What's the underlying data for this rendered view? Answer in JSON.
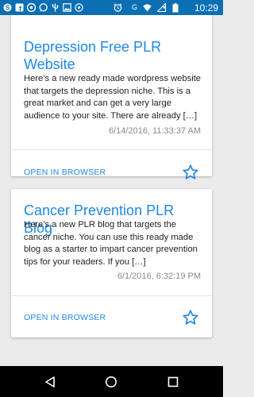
{
  "status_bar": {
    "time": "10:29",
    "icons": [
      "skype-icon",
      "facebook-icon",
      "chrome-icon",
      "whatsapp-icon",
      "usb-icon",
      "image-icon",
      "signal-circle-icon",
      "alarm-icon",
      "google-icon",
      "wifi-icon",
      "no-sim-icon",
      "battery-icon"
    ],
    "google_letter": "G"
  },
  "posts": [
    {
      "title": "Depression Free PLR Website",
      "excerpt": "Here’s a new ready made wordpress website that targets the depression niche. This is a great market and can get a very large audience to your site. There are already […]",
      "date": "6/14/2016, 11:33:37 AM",
      "open_label": "OPEN IN BROWSER",
      "favorite_icon": "star-outline-icon"
    },
    {
      "title": "Cancer Prevention PLR Blog",
      "excerpt": "Here’s a new PLR blog that targets the cancer niche. You can use this ready made blog as a starter to impart cancer prevention tips for your readers. If you […]",
      "date": "6/1/2016, 6:32:19 PM",
      "open_label": "OPEN IN BROWSER",
      "favorite_icon": "star-outline-icon"
    }
  ],
  "nav_bar": {
    "buttons": [
      "back-icon",
      "home-icon",
      "recents-icon"
    ]
  },
  "colors": {
    "status_bar": "#0c6fb4",
    "accent": "#1e88e5",
    "background": "#ebebeb",
    "date_text": "#8a8a8a",
    "nav_bar": "#000000"
  }
}
